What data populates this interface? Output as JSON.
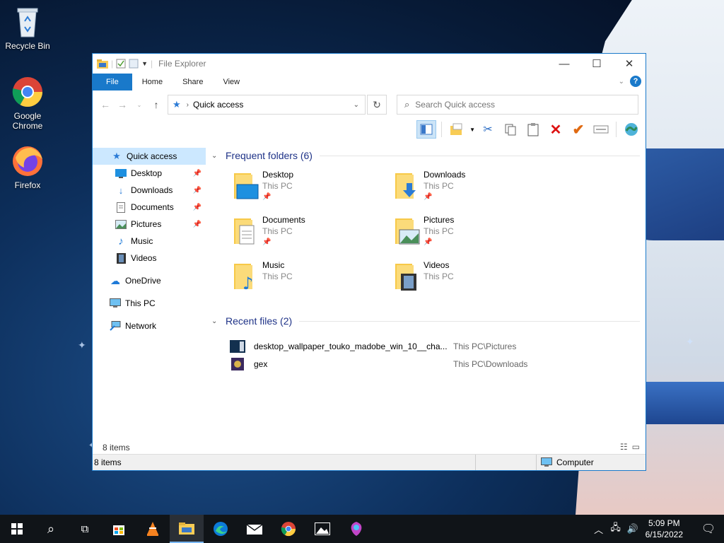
{
  "desktop": {
    "icons": [
      {
        "label": "Recycle Bin",
        "icon": "recycle-bin-icon"
      },
      {
        "label": "Google Chrome",
        "icon": "chrome-icon"
      },
      {
        "label": "Firefox",
        "icon": "firefox-icon"
      }
    ]
  },
  "window": {
    "title": "File Explorer",
    "tabs": {
      "file": "File",
      "home": "Home",
      "share": "Share",
      "view": "View"
    },
    "help_label": "?"
  },
  "nav": {
    "address": "Quick access",
    "search_placeholder": "Search Quick access"
  },
  "sidebar": {
    "items": [
      {
        "label": "Quick access",
        "icon": "star-icon"
      },
      {
        "label": "Desktop",
        "icon": "desktop-icon"
      },
      {
        "label": "Downloads",
        "icon": "download-icon"
      },
      {
        "label": "Documents",
        "icon": "document-icon"
      },
      {
        "label": "Pictures",
        "icon": "picture-icon"
      },
      {
        "label": "Music",
        "icon": "music-icon"
      },
      {
        "label": "Videos",
        "icon": "video-icon"
      },
      {
        "label": "OneDrive",
        "icon": "cloud-icon"
      },
      {
        "label": "This PC",
        "icon": "computer-icon"
      },
      {
        "label": "Network",
        "icon": "network-icon"
      }
    ]
  },
  "content": {
    "frequent_header": "Frequent folders (6)",
    "folders": [
      {
        "name": "Desktop",
        "location": "This PC",
        "icon": "desktop-folder-icon"
      },
      {
        "name": "Downloads",
        "location": "This PC",
        "icon": "downloads-folder-icon"
      },
      {
        "name": "Documents",
        "location": "This PC",
        "icon": "documents-folder-icon"
      },
      {
        "name": "Pictures",
        "location": "This PC",
        "icon": "pictures-folder-icon"
      },
      {
        "name": "Music",
        "location": "This PC",
        "icon": "music-folder-icon"
      },
      {
        "name": "Videos",
        "location": "This PC",
        "icon": "videos-folder-icon"
      }
    ],
    "recent_header": "Recent files (2)",
    "recent": [
      {
        "name": "desktop_wallpaper_touko_madobe_win_10__cha...",
        "location": "This PC\\Pictures"
      },
      {
        "name": "gex",
        "location": "This PC\\Downloads"
      }
    ],
    "item_count": "8 items"
  },
  "statusbar": {
    "left": "8 items",
    "right": "Computer"
  },
  "taskbar": {
    "time": "5:09 PM",
    "date": "6/15/2022"
  },
  "colors": {
    "accent": "#1979ca",
    "selection": "#cce8ff",
    "group_header": "#1e3287"
  }
}
